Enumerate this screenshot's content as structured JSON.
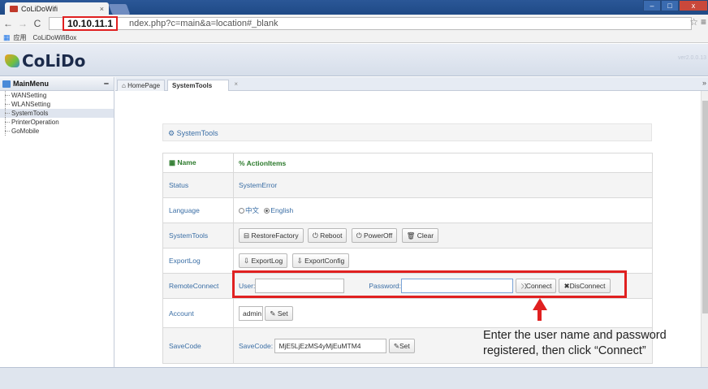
{
  "browser": {
    "tab_title": "CoLiDoWifi",
    "tab_close": "×",
    "url_host": "10.10.11.1",
    "url_rest": "ndex.php?c=main&a=location#_blank",
    "bookmark_apps": "应用",
    "bookmark_colido": "CoLiDoWifiBox"
  },
  "app": {
    "logo_text": "CoLiDo",
    "version": "ver2.0.0.13"
  },
  "leftmenu": {
    "title": "MainMenu",
    "items": [
      "WANSetting",
      "WLANSetting",
      "SystemTools",
      "PrinterOperation",
      "GoMobile"
    ],
    "active_index": 2
  },
  "tabs": {
    "home": "HomePage",
    "system": "SystemTools",
    "close": "×"
  },
  "panel": {
    "title": "SystemTools"
  },
  "table": {
    "col_name": "Name",
    "col_actions": "ActionItems",
    "rows": {
      "status": {
        "label": "Status",
        "value": "SystemError"
      },
      "language": {
        "label": "Language",
        "opt1": "中文",
        "opt2": "English",
        "selected": "English"
      },
      "systools": {
        "label": "SystemTools",
        "b1": "RestoreFactory",
        "b2": "Reboot",
        "b3": "PowerOff",
        "b4": "Clear"
      },
      "exportlog": {
        "label": "ExportLog",
        "b1": "ExportLog",
        "b2": "ExportConfig"
      },
      "remote": {
        "label": "RemoteConnect",
        "user_label": "User:",
        "user_value": "",
        "pwd_label": "Password:",
        "pwd_value": "",
        "connect": "Connect",
        "disconnect": "DisConnect"
      },
      "account": {
        "label": "Account",
        "value": "admin",
        "set": "Set"
      },
      "savecode": {
        "label": "SaveCode",
        "field_label": "SaveCode:",
        "value": "MjE5LjEzMS4yMjEuMTM4",
        "set": "Set"
      }
    }
  },
  "annotation": {
    "line1": "Enter the user name and password",
    "line2": "registered, then click “Connect”",
    "color": "#e02020"
  }
}
